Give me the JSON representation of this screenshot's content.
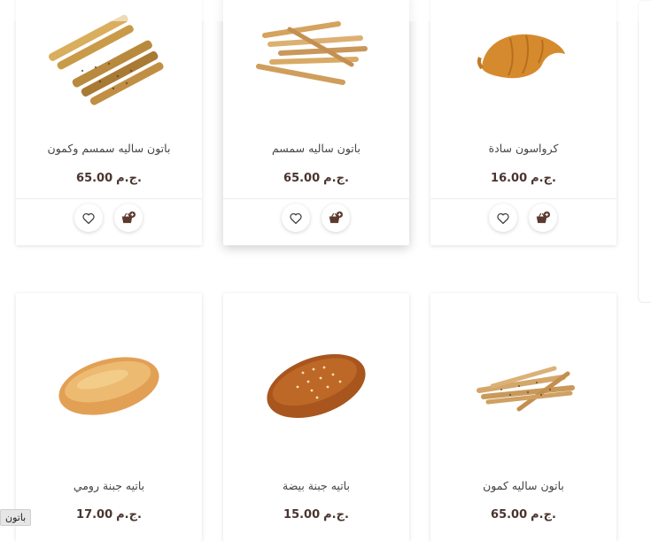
{
  "currency": "ج.م.",
  "products": [
    {
      "name": "باتون ساليه سمسم وكمون",
      "price": "65.00",
      "image": "sesame-cumin-sticks"
    },
    {
      "name": "باتون ساليه سمسم",
      "price": "65.00",
      "image": "sesame-sticks"
    },
    {
      "name": "كرواسون سادة",
      "price": "16.00",
      "image": "croissant"
    },
    {
      "name": "باتيه جبنة رومي",
      "price": "17.00",
      "image": "roumi-cheese-pate"
    },
    {
      "name": "باتيه جبنة بيضة",
      "price": "15.00",
      "image": "white-cheese-pate"
    },
    {
      "name": "باتون ساليه كمون",
      "price": "65.00",
      "image": "cumin-sticks"
    }
  ],
  "icons": {
    "wishlist": "heart-icon",
    "cart": "add-to-cart-icon"
  },
  "colors": {
    "price": "#4a3530",
    "cart_badge": "#5b3a2e"
  },
  "tooltip": {
    "text": "باتون"
  }
}
